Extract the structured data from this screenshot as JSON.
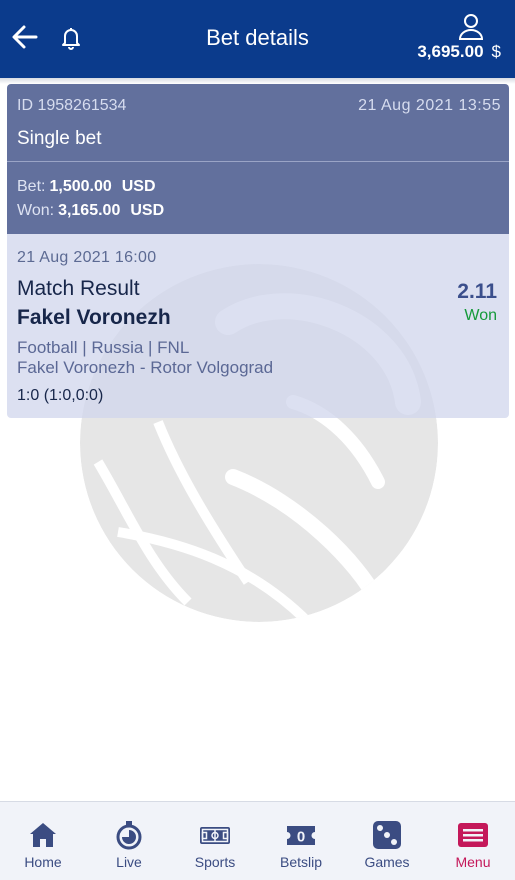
{
  "header": {
    "title": "Bet details",
    "balance": "3,695.00",
    "currency": "$"
  },
  "bet": {
    "id": "ID 1958261534",
    "placed_at": "21 Aug  2021  13:55",
    "type": "Single bet",
    "bet_label": "Bet:",
    "bet_amount": "1,500.00",
    "bet_currency": "USD",
    "won_label": "Won:",
    "won_amount": "3,165.00",
    "won_currency": "USD"
  },
  "event": {
    "date": "21  Aug  2021  16:00",
    "market": "Match  Result",
    "pick": "Fakel  Voronezh",
    "odds": "2.11",
    "status": "Won",
    "league": "Football  |  Russia  |  FNL",
    "teams": "Fakel  Voronezh  -  Rotor  Volgograd",
    "score": "1:0  (1:0,0:0)"
  },
  "betslip_count": "0",
  "nav": {
    "home": "Home",
    "live": "Live",
    "sports": "Sports",
    "betslip": "Betslip",
    "games": "Games",
    "menu": "Menu"
  },
  "icons": {
    "back": "arrow-left-icon",
    "notifications": "bell-icon",
    "account": "user-icon",
    "watermark": "ball-watermark-icon"
  },
  "colors": {
    "header": "#0b3b8c",
    "card": "#62709d",
    "won": "#159a3a",
    "nav_active": "#c4185a",
    "nav_inactive": "#3b4c82"
  }
}
